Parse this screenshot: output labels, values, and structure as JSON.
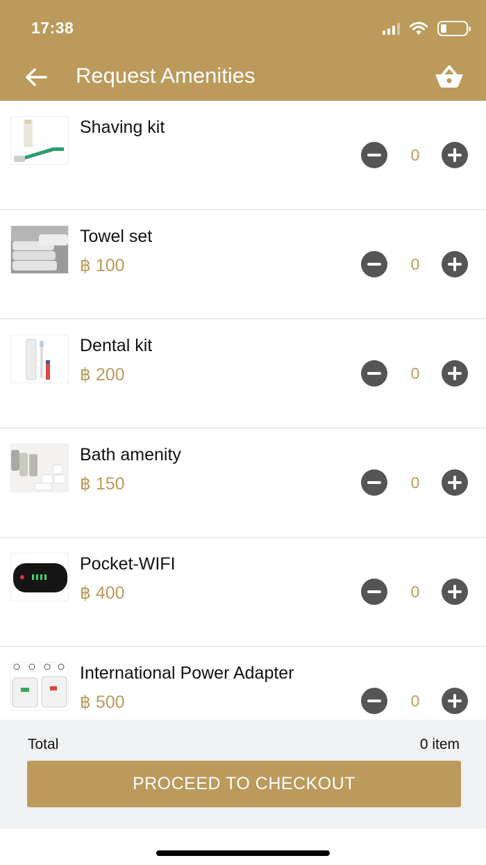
{
  "status": {
    "time": "17:38"
  },
  "header": {
    "title": "Request Amenities"
  },
  "icons": {
    "back": "back-arrow-icon",
    "basket": "basket-icon"
  },
  "colors": {
    "brand": "#bc9a5c",
    "stepper": "#555555",
    "footer_bg": "#f1f2f4"
  },
  "items": [
    {
      "name": "Shaving kit",
      "price": "",
      "qty": "0",
      "image": "shaving-kit-image"
    },
    {
      "name": "Towel set",
      "price": "฿ 100",
      "qty": "0",
      "image": "towel-set-image"
    },
    {
      "name": "Dental kit",
      "price": "฿ 200",
      "qty": "0",
      "image": "dental-kit-image"
    },
    {
      "name": "Bath amenity",
      "price": "฿ 150",
      "qty": "0",
      "image": "bath-amenity-image"
    },
    {
      "name": "Pocket-WIFI",
      "price": "฿ 400",
      "qty": "0",
      "image": "pocket-wifi-image"
    },
    {
      "name": "International Power Adapter",
      "price": "฿ 500",
      "qty": "0",
      "image": "power-adapter-image"
    }
  ],
  "footer": {
    "total_label": "Total",
    "total_count": "0 item",
    "checkout_label": "PROCEED TO CHECKOUT"
  }
}
